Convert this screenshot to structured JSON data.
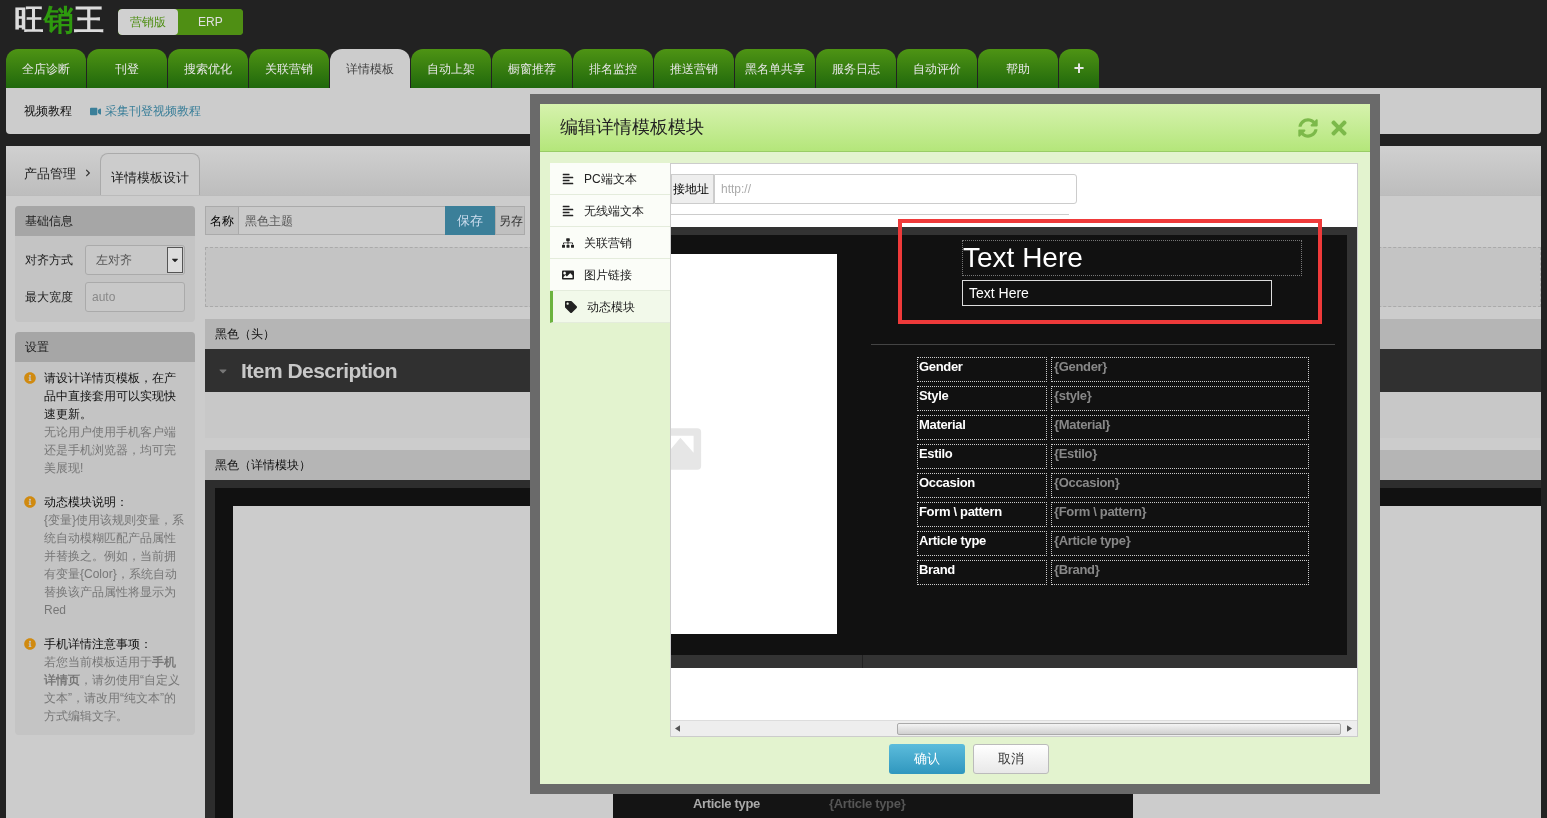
{
  "header": {
    "logo": [
      {
        "text": "旺",
        "highlight": false
      },
      {
        "text": "销",
        "highlight": true
      },
      {
        "text": "王",
        "highlight": false
      }
    ],
    "editions": [
      {
        "label": "营销版",
        "selected": true
      },
      {
        "label": "ERP",
        "selected": false
      }
    ]
  },
  "nav_tabs": [
    {
      "label": "全店诊断",
      "selected": false,
      "kind": "tab"
    },
    {
      "label": "刊登",
      "selected": false,
      "kind": "tab"
    },
    {
      "label": "搜索优化",
      "selected": false,
      "kind": "tab"
    },
    {
      "label": "关联营销",
      "selected": false,
      "kind": "tab"
    },
    {
      "label": "详情模板",
      "selected": true,
      "kind": "tab"
    },
    {
      "label": "自动上架",
      "selected": false,
      "kind": "tab"
    },
    {
      "label": "橱窗推荐",
      "selected": false,
      "kind": "tab"
    },
    {
      "label": "排名监控",
      "selected": false,
      "kind": "tab"
    },
    {
      "label": "推送营销",
      "selected": false,
      "kind": "tab"
    },
    {
      "label": "黑名单共享",
      "selected": false,
      "kind": "tab"
    },
    {
      "label": "服务日志",
      "selected": false,
      "kind": "tab"
    },
    {
      "label": "自动评价",
      "selected": false,
      "kind": "tab"
    },
    {
      "label": "帮助",
      "selected": false,
      "kind": "tab"
    },
    {
      "label": "+",
      "selected": false,
      "kind": "add"
    }
  ],
  "toolbar": {
    "title": "视频教程",
    "link": "采集刊登视频教程"
  },
  "breadcrumb": [
    {
      "label": "产品管理",
      "selected": false
    },
    {
      "label": "详情模板设计",
      "selected": true
    }
  ],
  "basic_info": {
    "title": "基础信息",
    "fields": [
      {
        "label": "对齐方式",
        "kind": "select",
        "value": "左对齐"
      },
      {
        "label": "最大宽度",
        "kind": "input",
        "placeholder": "auto"
      }
    ]
  },
  "settings": {
    "title": "设置",
    "notes": [
      {
        "heading": "请设计详情页模板，在产品中直接套用可以实现快速更新。",
        "body": "无论用户使用手机客户端还是手机浏览器，均可完美展现!"
      },
      {
        "heading": "动态模块说明：",
        "body": "{变量}使用该规则变量，系统自动模糊匹配产品属性并替换之。例如，当前拥有变量{Color}，系统自动替换该产品属性将显示为Red"
      },
      {
        "heading": "手机详情注意事项：",
        "body": "若您当前模板适用于**手机详情页**，请勿使用“自定义文本”，请改用“纯文本”的方式编辑文字。"
      }
    ]
  },
  "template": {
    "name_label": "名称",
    "name_value": "黑色主题",
    "save": "保存",
    "save_as": "另存",
    "sections": [
      {
        "title": "黑色（头）",
        "kind": "header",
        "heading": "Item Description"
      },
      {
        "title": "黑色（详情模块）",
        "kind": "detail",
        "rows": [
          {
            "label": "Article type",
            "value": "{Article type}"
          }
        ]
      }
    ]
  },
  "dialog": {
    "title": "编辑详情模板模块",
    "menu": [
      {
        "label": "PC端文本",
        "kind": "text",
        "selected": false
      },
      {
        "label": "无线端文本",
        "kind": "text",
        "selected": false
      },
      {
        "label": "关联营销",
        "kind": "links",
        "selected": false
      },
      {
        "label": "图片链接",
        "kind": "image",
        "selected": false
      },
      {
        "label": "动态模块",
        "kind": "tag",
        "selected": true
      }
    ],
    "url_label": "接地址",
    "url_placeholder": "http://",
    "preview": {
      "title": "Text Here",
      "subtitle": "Text Here",
      "highlighted": true,
      "attributes": [
        {
          "label": "Gender",
          "value": "{Gender}"
        },
        {
          "label": "Style",
          "value": "{style}"
        },
        {
          "label": "Material",
          "value": "{Material}"
        },
        {
          "label": "Estilo",
          "value": "{Estilo}"
        },
        {
          "label": "Occasion",
          "value": "{Occasion}"
        },
        {
          "label": "Form \\ pattern",
          "value": "{Form \\ pattern}"
        },
        {
          "label": "Article type",
          "value": "{Article type}"
        },
        {
          "label": "Brand",
          "value": "{Brand}"
        }
      ]
    },
    "buttons": [
      {
        "label": "确认",
        "kind": "primary"
      },
      {
        "label": "取消",
        "kind": "secondary"
      }
    ]
  }
}
